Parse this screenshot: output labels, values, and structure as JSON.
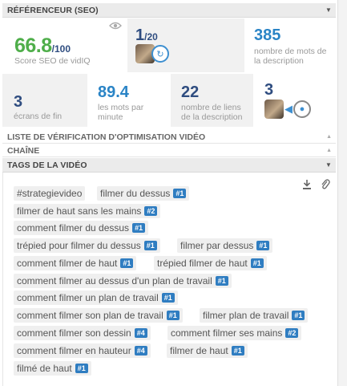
{
  "header": {
    "title": "RÉFÉRENCEUR (SEO)",
    "caret": "▼"
  },
  "score": {
    "value": "66.8",
    "denominator": "/100",
    "label": "Score SEO de vidIQ"
  },
  "rank_card": {
    "value": "1",
    "denominator": "/20"
  },
  "words_desc": {
    "value": "385",
    "label_line1": "nombre de mots de",
    "label_line2": "la description"
  },
  "end_screens": {
    "value": "3",
    "label": "écrans de fin"
  },
  "words_per_min": {
    "value": "89.4",
    "label_line1": "les mots par",
    "label_line2": "minute"
  },
  "links_desc": {
    "value": "22",
    "label_line1": "nombre de liens",
    "label_line2": "de la description"
  },
  "cards": {
    "value": "3"
  },
  "checklist": {
    "title": "LISTE DE VÉRIFICATION D'OPTIMISATION VIDÉO",
    "caret": "▲"
  },
  "channel": {
    "title": "CHAÎNE",
    "caret": "▲"
  },
  "tags_section": {
    "title": "TAGS DE LA VIDÉO",
    "caret": "▼"
  },
  "tags": [
    {
      "text": "#strategievideo",
      "rank": ""
    },
    {
      "text": "filmer du dessus",
      "rank": "#1"
    },
    {
      "text": "filmer de haut sans les mains",
      "rank": "#2"
    },
    {
      "text": "comment filmer du dessus",
      "rank": "#1"
    },
    {
      "text": "trépied pour filmer du dessus",
      "rank": "#1"
    },
    {
      "text": "filmer par dessus",
      "rank": "#1"
    },
    {
      "text": "comment filmer de haut",
      "rank": "#1"
    },
    {
      "text": "trépied filmer de haut",
      "rank": "#1"
    },
    {
      "text": "comment filmer au dessus d'un plan de travail",
      "rank": "#1"
    },
    {
      "text": "comment filmer un plan de travail",
      "rank": "#1"
    },
    {
      "text": "comment filmer son plan de travail",
      "rank": "#1"
    },
    {
      "text": "filmer plan de travail",
      "rank": "#1"
    },
    {
      "text": "comment filmer son dessin",
      "rank": "#4"
    },
    {
      "text": "comment filmer ses mains",
      "rank": "#2"
    },
    {
      "text": "comment filmer en hauteur",
      "rank": "#4"
    },
    {
      "text": "filmer de haut",
      "rank": "#1"
    },
    {
      "text": "filmé de haut",
      "rank": "#1"
    }
  ],
  "icons": {
    "eye": "eye-icon",
    "download": "download-icon",
    "paperclip": "paperclip-icon"
  },
  "colors": {
    "score_green": "#4fae4a",
    "rank_blue": "#2f7dc1",
    "stat_blue": "#2a84c6",
    "stat_navy": "#2f4d80"
  }
}
